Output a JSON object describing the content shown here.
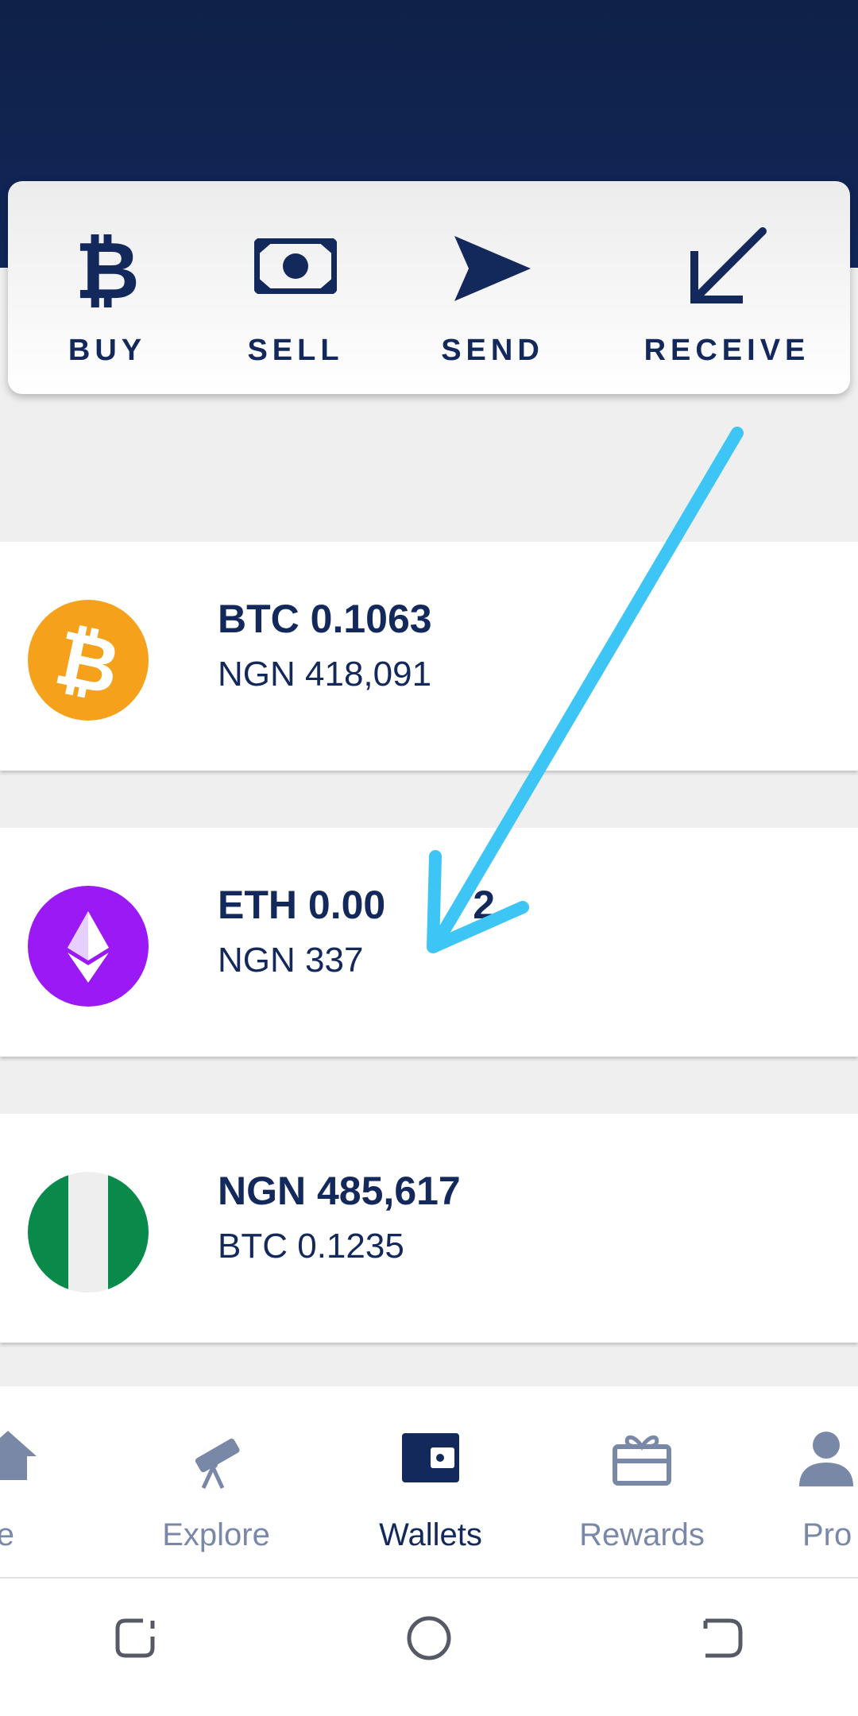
{
  "actions": [
    {
      "label": "BUY",
      "icon": "bitcoin-icon"
    },
    {
      "label": "SELL",
      "icon": "cash-icon"
    },
    {
      "label": "SEND",
      "icon": "send-icon"
    },
    {
      "label": "RECEIVE",
      "icon": "receive-arrow-icon"
    }
  ],
  "wallets": [
    {
      "primary": "BTC 0.1063",
      "secondary": "NGN 418,091",
      "icon": "bitcoin-coin-icon",
      "color": "#f5a11c"
    },
    {
      "primary": "ETH 0.00",
      "primary_tail": "2",
      "secondary": "NGN 337",
      "icon": "ethereum-coin-icon",
      "color": "#9b19f5"
    },
    {
      "primary": "NGN 485,617",
      "secondary": "BTC 0.1235",
      "icon": "nigeria-flag-icon",
      "color": "#0a8a4a"
    }
  ],
  "bottom_nav": [
    {
      "label": "me",
      "icon": "home-icon",
      "active": false
    },
    {
      "label": "Explore",
      "icon": "telescope-icon",
      "active": false
    },
    {
      "label": "Wallets",
      "icon": "wallet-icon",
      "active": true
    },
    {
      "label": "Rewards",
      "icon": "gift-icon",
      "active": false
    },
    {
      "label": "Pro",
      "icon": "profile-icon",
      "active": false
    }
  ],
  "colors": {
    "header": "#11275a",
    "brand_text": "#13285b",
    "nav_inactive": "#7a88a8",
    "annotation_arrow": "#3dc6f5"
  }
}
